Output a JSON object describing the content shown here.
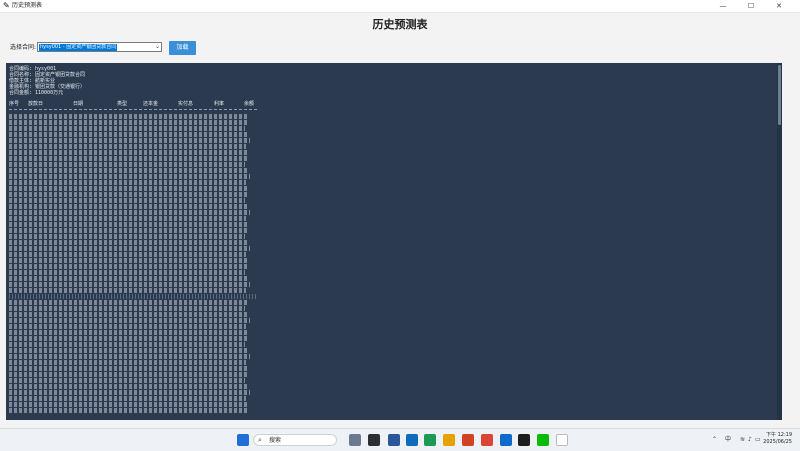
{
  "window": {
    "title": "历史预测表",
    "minimize_glyph": "—",
    "maximize_glyph": "☐",
    "close_glyph": "✕"
  },
  "page": {
    "heading": "历史预测表",
    "contract_label": "选择合同:",
    "contract_value": "hysy001 - 固定资产银团贷款合同",
    "load_button": "加载"
  },
  "output": {
    "info_lines": [
      "合同编码: hysy001",
      "合同名称: 固定资产银团贷款合同",
      "借款主体: 航新实业",
      "金融机构: 银团贷款（交通银行）",
      "合同金额: 110000万元"
    ],
    "headers": [
      "序号",
      "放款日",
      "日期",
      "类型",
      "还本金",
      "实付息",
      "利率",
      "余额"
    ]
  },
  "taskbar": {
    "search_placeholder": "搜索",
    "ime_label": "中",
    "time": "下午 12:19",
    "date": "2025/06/25"
  },
  "icons": {
    "app": "feather-icon",
    "windows": "windows-start-icon",
    "search": "search-icon",
    "wifi": "wifi-icon",
    "volume": "volume-icon",
    "battery": "battery-icon"
  },
  "colors": {
    "console_bg": "#2b3a4e",
    "accent_button": "#3b8fd8",
    "selection": "#0078d7"
  }
}
